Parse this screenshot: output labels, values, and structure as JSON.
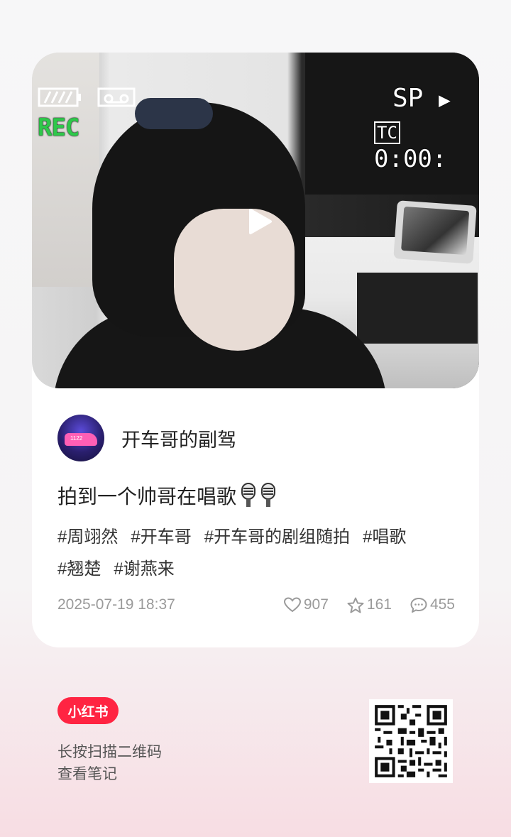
{
  "cover": {
    "hud_rec": "REC",
    "hud_sp": "SP",
    "hud_timecode": "0:00:"
  },
  "author": {
    "name": "开车哥的副驾",
    "avatar_plate": "1122"
  },
  "post": {
    "title": "拍到一个帅哥在唱歌",
    "title_icons": [
      "microphone-icon",
      "microphone-icon"
    ],
    "tags": [
      "#周翊然",
      "#开车哥",
      "#开车哥的剧组随拍",
      "#唱歌",
      "#翘楚",
      "#谢燕来"
    ],
    "date": "2025-07-19 18:37",
    "likes": "907",
    "favorites": "161",
    "comments": "455"
  },
  "footer": {
    "logo": "小红书",
    "line1": "长按扫描二维码",
    "line2": "查看笔记"
  },
  "colors": {
    "brand": "#ff2442",
    "rec": "#2ec74a"
  }
}
